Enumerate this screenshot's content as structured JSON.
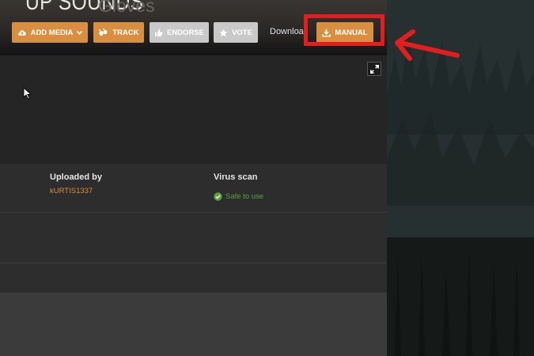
{
  "header": {
    "title": "UP SOUNDS",
    "subtitle": "Gloves"
  },
  "toolbar": {
    "add_media_label": "ADD MEDIA",
    "track_label": "TRACK",
    "endorse_label": "ENDORSE",
    "vote_label": "VOTE",
    "download_text": "Downloa",
    "manual_label": "MANUAL"
  },
  "info": {
    "uploaded_by_label": "Uploaded by",
    "uploader": "kURTIS1337",
    "virus_scan_label": "Virus scan",
    "virus_status": "Safe to use"
  },
  "colors": {
    "accent": "#d98f40",
    "highlight": "#e41e1e",
    "safe": "#5aa13d"
  },
  "icons": [
    "upload-cloud-icon",
    "chevron-down-icon",
    "track-icon",
    "thumbs-up-icon",
    "star-icon",
    "download-icon",
    "expand-icon",
    "cursor-icon",
    "check-circle-icon",
    "arrow-icon"
  ]
}
